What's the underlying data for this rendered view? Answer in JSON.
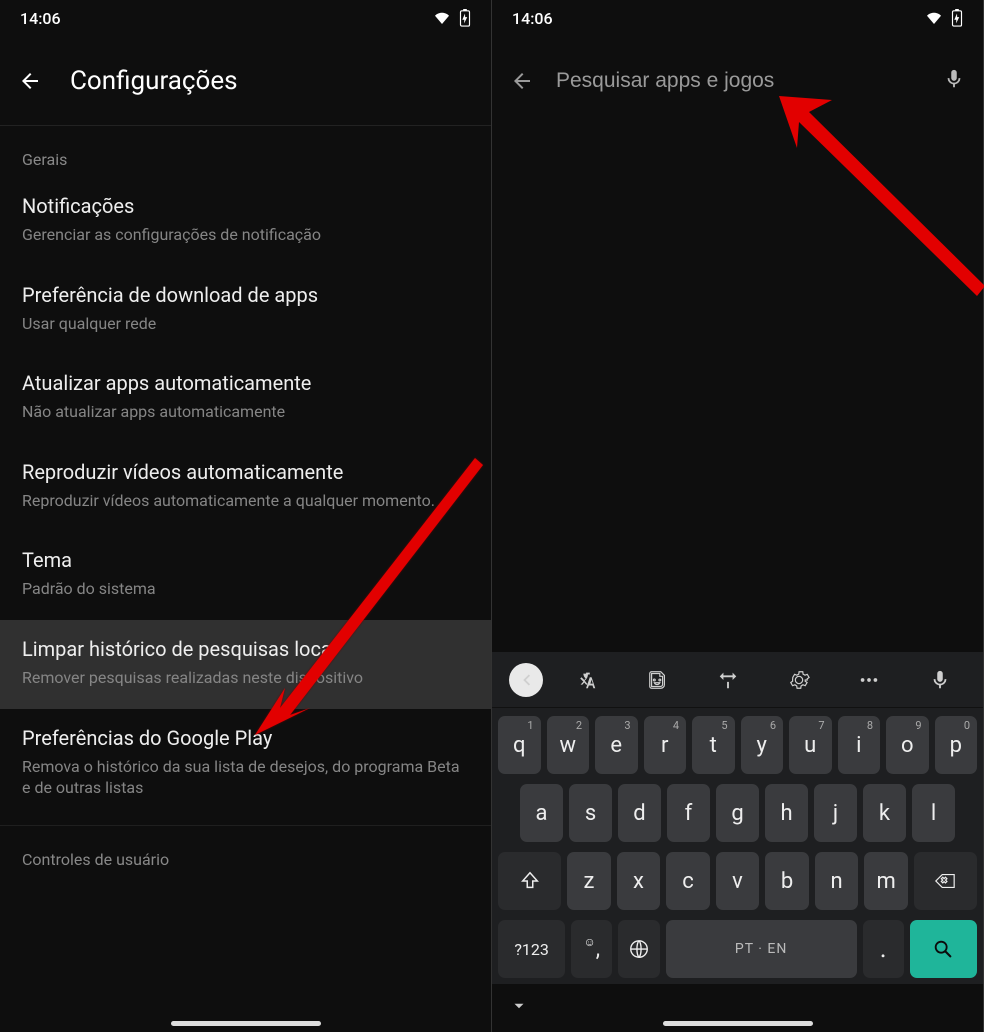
{
  "status": {
    "time": "14:06"
  },
  "left": {
    "title": "Configurações",
    "section_header": "Gerais",
    "items": [
      {
        "title": "Notificações",
        "sub": "Gerenciar as configurações de notificação"
      },
      {
        "title": "Preferência de download de apps",
        "sub": "Usar qualquer rede"
      },
      {
        "title": "Atualizar apps automaticamente",
        "sub": "Não atualizar apps automaticamente"
      },
      {
        "title": "Reproduzir vídeos automaticamente",
        "sub": "Reproduzir vídeos automaticamente a qualquer momento."
      },
      {
        "title": "Tema",
        "sub": "Padrão do sistema"
      },
      {
        "title": "Limpar histórico de pesquisas local",
        "sub": "Remover pesquisas realizadas neste dispositivo"
      },
      {
        "title": "Preferências do Google Play",
        "sub": "Remova o histórico da sua lista de desejos, do programa Beta e de outras listas"
      }
    ],
    "section2": "Controles de usuário"
  },
  "right": {
    "search_placeholder": "Pesquisar apps e jogos",
    "keyboard": {
      "row1": [
        {
          "k": "q",
          "s": "1"
        },
        {
          "k": "w",
          "s": "2"
        },
        {
          "k": "e",
          "s": "3"
        },
        {
          "k": "r",
          "s": "4"
        },
        {
          "k": "t",
          "s": "5"
        },
        {
          "k": "y",
          "s": "6"
        },
        {
          "k": "u",
          "s": "7"
        },
        {
          "k": "i",
          "s": "8"
        },
        {
          "k": "o",
          "s": "9"
        },
        {
          "k": "p",
          "s": "0"
        }
      ],
      "row2": [
        {
          "k": "a"
        },
        {
          "k": "s"
        },
        {
          "k": "d"
        },
        {
          "k": "f"
        },
        {
          "k": "g"
        },
        {
          "k": "h"
        },
        {
          "k": "j"
        },
        {
          "k": "k"
        },
        {
          "k": "l"
        }
      ],
      "row3": [
        {
          "k": "z"
        },
        {
          "k": "x"
        },
        {
          "k": "c"
        },
        {
          "k": "v"
        },
        {
          "k": "b"
        },
        {
          "k": "n"
        },
        {
          "k": "m"
        }
      ],
      "numLabel": "?123",
      "spaceLabel": "PT · EN"
    }
  }
}
